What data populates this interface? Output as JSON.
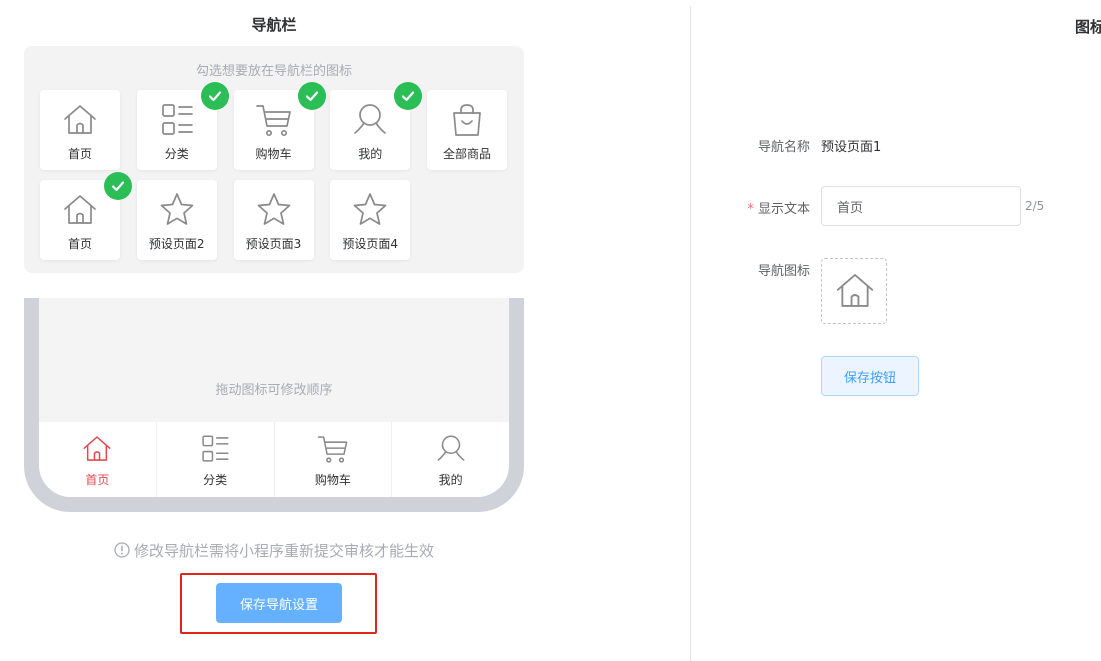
{
  "header": {
    "left_title": "导航栏",
    "right_title": "图标"
  },
  "picker": {
    "hint": "勾选想要放在导航栏的图标",
    "items": [
      {
        "label": "首页",
        "icon": "home-icon",
        "checked": false
      },
      {
        "label": "分类",
        "icon": "category-icon",
        "checked": true
      },
      {
        "label": "购物车",
        "icon": "cart-icon",
        "checked": true
      },
      {
        "label": "我的",
        "icon": "user-icon",
        "checked": true
      },
      {
        "label": "全部商品",
        "icon": "bag-icon",
        "checked": false
      },
      {
        "label": "首页",
        "icon": "home-icon",
        "checked": true
      },
      {
        "label": "预设页面2",
        "icon": "star-icon",
        "checked": false
      },
      {
        "label": "预设页面3",
        "icon": "star-icon",
        "checked": false
      },
      {
        "label": "预设页面4",
        "icon": "star-icon",
        "checked": false
      }
    ]
  },
  "phone": {
    "drag_hint": "拖动图标可修改顺序",
    "tabs": [
      {
        "label": "首页",
        "icon": "home-icon",
        "active": true
      },
      {
        "label": "分类",
        "icon": "category-icon",
        "active": false
      },
      {
        "label": "购物车",
        "icon": "cart-icon",
        "active": false
      },
      {
        "label": "我的",
        "icon": "user-icon",
        "active": false
      }
    ]
  },
  "notice": "修改导航栏需将小程序重新提交审核才能生效",
  "save_nav_label": "保存导航设置",
  "form": {
    "name_label": "导航名称",
    "name_value": "预设页面1",
    "text_label": "显示文本",
    "text_value": "首页",
    "text_counter": "2/5",
    "icon_label": "导航图标",
    "icon": "home-icon",
    "save_label": "保存按钮"
  },
  "colors": {
    "accent": "#66b1ff",
    "active_tab": "#e5484d",
    "check": "#2bbd56",
    "highlight": "#e0261d"
  }
}
